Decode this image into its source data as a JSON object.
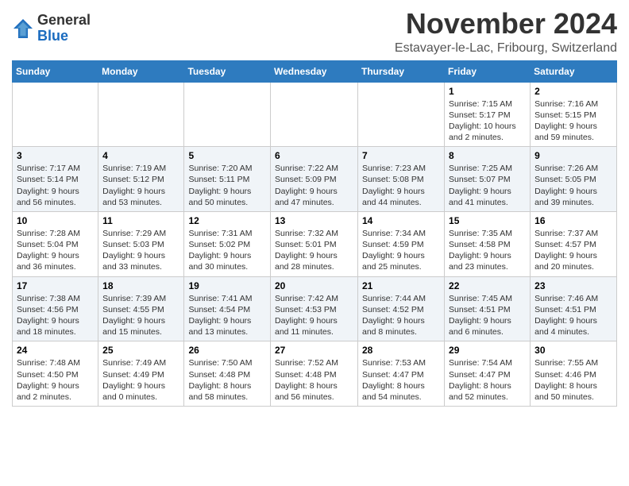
{
  "logo": {
    "general": "General",
    "blue": "Blue"
  },
  "header": {
    "month": "November 2024",
    "location": "Estavayer-le-Lac, Fribourg, Switzerland"
  },
  "weekdays": [
    "Sunday",
    "Monday",
    "Tuesday",
    "Wednesday",
    "Thursday",
    "Friday",
    "Saturday"
  ],
  "weeks": [
    [
      {
        "day": "",
        "info": ""
      },
      {
        "day": "",
        "info": ""
      },
      {
        "day": "",
        "info": ""
      },
      {
        "day": "",
        "info": ""
      },
      {
        "day": "",
        "info": ""
      },
      {
        "day": "1",
        "info": "Sunrise: 7:15 AM\nSunset: 5:17 PM\nDaylight: 10 hours\nand 2 minutes."
      },
      {
        "day": "2",
        "info": "Sunrise: 7:16 AM\nSunset: 5:15 PM\nDaylight: 9 hours\nand 59 minutes."
      }
    ],
    [
      {
        "day": "3",
        "info": "Sunrise: 7:17 AM\nSunset: 5:14 PM\nDaylight: 9 hours\nand 56 minutes."
      },
      {
        "day": "4",
        "info": "Sunrise: 7:19 AM\nSunset: 5:12 PM\nDaylight: 9 hours\nand 53 minutes."
      },
      {
        "day": "5",
        "info": "Sunrise: 7:20 AM\nSunset: 5:11 PM\nDaylight: 9 hours\nand 50 minutes."
      },
      {
        "day": "6",
        "info": "Sunrise: 7:22 AM\nSunset: 5:09 PM\nDaylight: 9 hours\nand 47 minutes."
      },
      {
        "day": "7",
        "info": "Sunrise: 7:23 AM\nSunset: 5:08 PM\nDaylight: 9 hours\nand 44 minutes."
      },
      {
        "day": "8",
        "info": "Sunrise: 7:25 AM\nSunset: 5:07 PM\nDaylight: 9 hours\nand 41 minutes."
      },
      {
        "day": "9",
        "info": "Sunrise: 7:26 AM\nSunset: 5:05 PM\nDaylight: 9 hours\nand 39 minutes."
      }
    ],
    [
      {
        "day": "10",
        "info": "Sunrise: 7:28 AM\nSunset: 5:04 PM\nDaylight: 9 hours\nand 36 minutes."
      },
      {
        "day": "11",
        "info": "Sunrise: 7:29 AM\nSunset: 5:03 PM\nDaylight: 9 hours\nand 33 minutes."
      },
      {
        "day": "12",
        "info": "Sunrise: 7:31 AM\nSunset: 5:02 PM\nDaylight: 9 hours\nand 30 minutes."
      },
      {
        "day": "13",
        "info": "Sunrise: 7:32 AM\nSunset: 5:01 PM\nDaylight: 9 hours\nand 28 minutes."
      },
      {
        "day": "14",
        "info": "Sunrise: 7:34 AM\nSunset: 4:59 PM\nDaylight: 9 hours\nand 25 minutes."
      },
      {
        "day": "15",
        "info": "Sunrise: 7:35 AM\nSunset: 4:58 PM\nDaylight: 9 hours\nand 23 minutes."
      },
      {
        "day": "16",
        "info": "Sunrise: 7:37 AM\nSunset: 4:57 PM\nDaylight: 9 hours\nand 20 minutes."
      }
    ],
    [
      {
        "day": "17",
        "info": "Sunrise: 7:38 AM\nSunset: 4:56 PM\nDaylight: 9 hours\nand 18 minutes."
      },
      {
        "day": "18",
        "info": "Sunrise: 7:39 AM\nSunset: 4:55 PM\nDaylight: 9 hours\nand 15 minutes."
      },
      {
        "day": "19",
        "info": "Sunrise: 7:41 AM\nSunset: 4:54 PM\nDaylight: 9 hours\nand 13 minutes."
      },
      {
        "day": "20",
        "info": "Sunrise: 7:42 AM\nSunset: 4:53 PM\nDaylight: 9 hours\nand 11 minutes."
      },
      {
        "day": "21",
        "info": "Sunrise: 7:44 AM\nSunset: 4:52 PM\nDaylight: 9 hours\nand 8 minutes."
      },
      {
        "day": "22",
        "info": "Sunrise: 7:45 AM\nSunset: 4:51 PM\nDaylight: 9 hours\nand 6 minutes."
      },
      {
        "day": "23",
        "info": "Sunrise: 7:46 AM\nSunset: 4:51 PM\nDaylight: 9 hours\nand 4 minutes."
      }
    ],
    [
      {
        "day": "24",
        "info": "Sunrise: 7:48 AM\nSunset: 4:50 PM\nDaylight: 9 hours\nand 2 minutes."
      },
      {
        "day": "25",
        "info": "Sunrise: 7:49 AM\nSunset: 4:49 PM\nDaylight: 9 hours\nand 0 minutes."
      },
      {
        "day": "26",
        "info": "Sunrise: 7:50 AM\nSunset: 4:48 PM\nDaylight: 8 hours\nand 58 minutes."
      },
      {
        "day": "27",
        "info": "Sunrise: 7:52 AM\nSunset: 4:48 PM\nDaylight: 8 hours\nand 56 minutes."
      },
      {
        "day": "28",
        "info": "Sunrise: 7:53 AM\nSunset: 4:47 PM\nDaylight: 8 hours\nand 54 minutes."
      },
      {
        "day": "29",
        "info": "Sunrise: 7:54 AM\nSunset: 4:47 PM\nDaylight: 8 hours\nand 52 minutes."
      },
      {
        "day": "30",
        "info": "Sunrise: 7:55 AM\nSunset: 4:46 PM\nDaylight: 8 hours\nand 50 minutes."
      }
    ]
  ]
}
